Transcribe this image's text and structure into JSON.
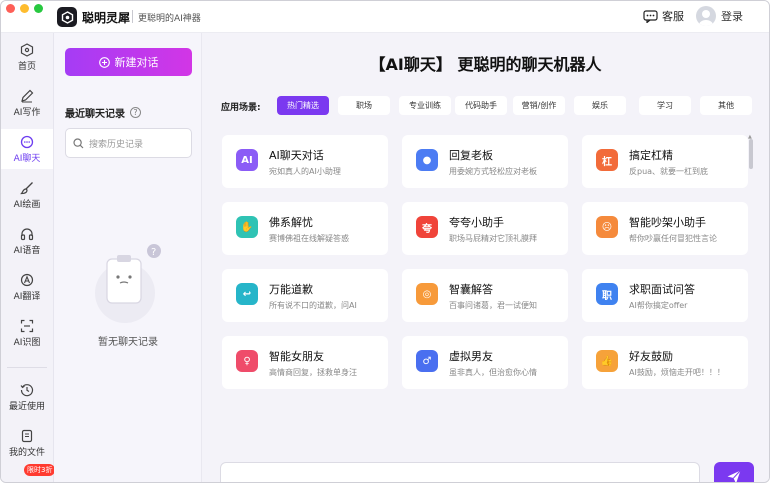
{
  "titlebar": {
    "app_name": "聪明灵犀",
    "slogan": "更聪明的AI神器",
    "support_label": "客服",
    "login_label": "登录"
  },
  "nav": {
    "items": [
      {
        "label": "首页",
        "icon": "home-icon"
      },
      {
        "label": "AI写作",
        "icon": "pen-icon"
      },
      {
        "label": "AI聊天",
        "icon": "chat-icon"
      },
      {
        "label": "AI绘画",
        "icon": "brush-icon"
      },
      {
        "label": "AI语音",
        "icon": "headphones-icon"
      },
      {
        "label": "AI翻译",
        "icon": "translate-icon"
      },
      {
        "label": "AI识图",
        "icon": "scan-icon"
      },
      {
        "label": "最近使用",
        "icon": "history-icon"
      },
      {
        "label": "我的文件",
        "icon": "file-icon"
      }
    ],
    "active": "AI聊天",
    "discount_badge": "限时3折"
  },
  "history": {
    "new_chat_label": "新建对话",
    "title": "最近聊天记录",
    "help_mark": "?",
    "search_placeholder": "搜索历史记录",
    "empty_text": "暂无聊天记录"
  },
  "main": {
    "headline": "【AI聊天】 更聪明的聊天机器人",
    "scene_label": "应用场景:",
    "tabs": [
      "热门精选",
      "职场",
      "专业训练",
      "代码助手",
      "营销/创作",
      "娱乐",
      "学习",
      "其他"
    ],
    "active_tab": "热门精选",
    "cards": [
      {
        "title": "AI聊天对话",
        "desc": "宛如真人的AI小助理",
        "icon": "robot-chat-icon",
        "glyph": "AI",
        "color": "#8b5cf6"
      },
      {
        "title": "回复老板",
        "desc": "用委婉方式轻松应对老板",
        "icon": "boss-icon",
        "glyph": "●",
        "color": "#4c7cf3"
      },
      {
        "title": "搞定杠精",
        "desc": "反pua、就要一杠到底",
        "icon": "bar-icon",
        "glyph": "杠",
        "color": "#f26b3a"
      },
      {
        "title": "佛系解忧",
        "desc": "赛博佛祖在线解疑答惑",
        "icon": "pray-hands-icon",
        "glyph": "✋",
        "color": "#2fc3b4"
      },
      {
        "title": "夸夸小助手",
        "desc": "职场马屁精对它顶礼膜拜",
        "icon": "praise-icon",
        "glyph": "夸",
        "color": "#f0443a"
      },
      {
        "title": "智能吵架小助手",
        "desc": "帮你吵赢任何冒犯性言论",
        "icon": "angry-face-icon",
        "glyph": "☹",
        "color": "#f58a3c"
      },
      {
        "title": "万能道歉",
        "desc": "所有说不口的道歉，问AI",
        "icon": "apology-icon",
        "glyph": "↩",
        "color": "#26b5c9"
      },
      {
        "title": "智囊解答",
        "desc": "百事问诸葛，君一试便知",
        "icon": "wise-icon",
        "glyph": "◎",
        "color": "#f79a3a"
      },
      {
        "title": "求职面试问答",
        "desc": "AI帮你搞定offer",
        "icon": "interview-icon",
        "glyph": "职",
        "color": "#3f82f0"
      },
      {
        "title": "智能女朋友",
        "desc": "高情商回复，拯救单身汪",
        "icon": "girlfriend-icon",
        "glyph": "♀",
        "color": "#ef4c6a"
      },
      {
        "title": "虚拟男友",
        "desc": "虽非真人，但治愈你心情",
        "icon": "boyfriend-icon",
        "glyph": "♂",
        "color": "#4a6ff0"
      },
      {
        "title": "好友鼓励",
        "desc": "AI鼓励，烦恼走开吧！！！",
        "icon": "thumbs-up-icon",
        "glyph": "👍",
        "color": "#f6a23a"
      }
    ]
  }
}
